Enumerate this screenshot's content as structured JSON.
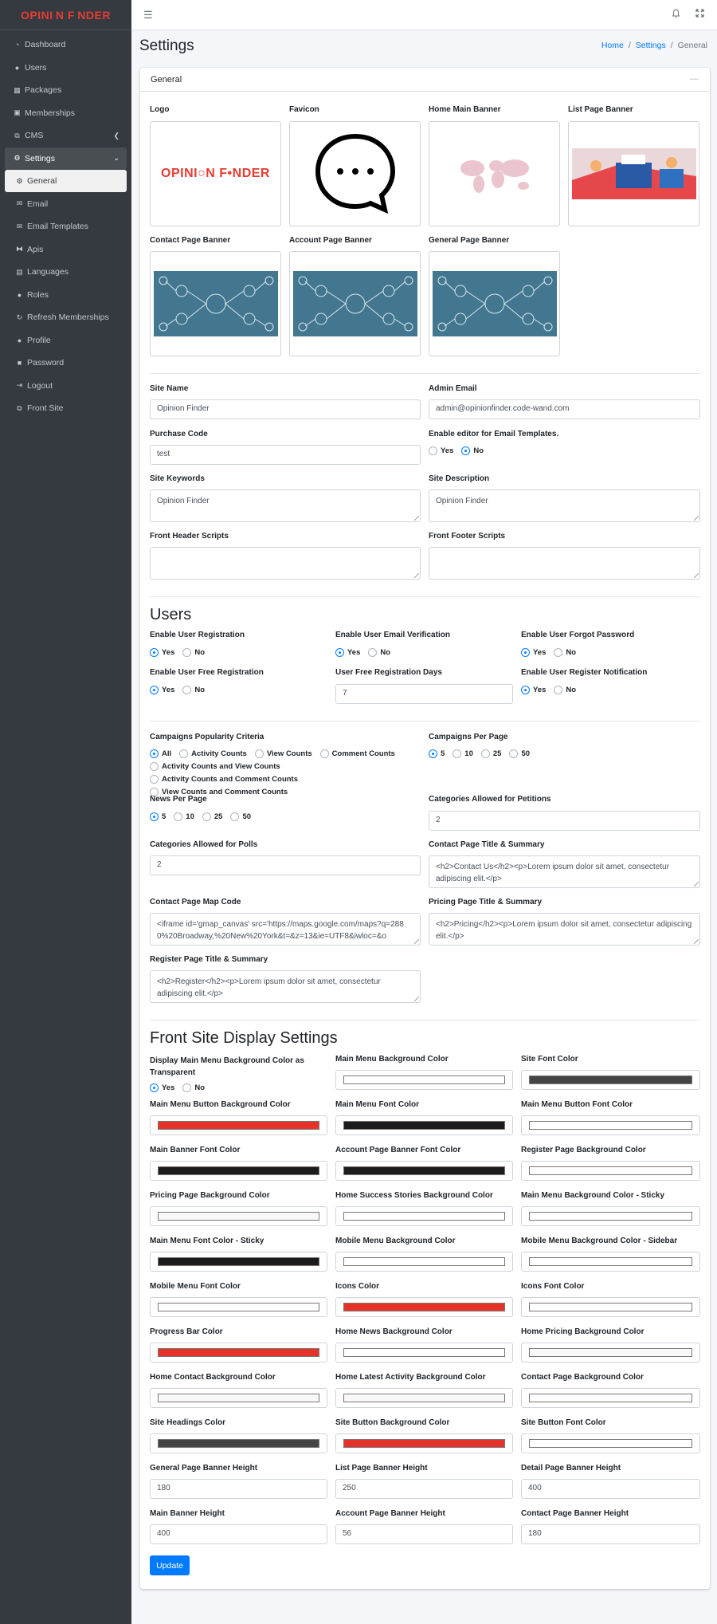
{
  "brand": {
    "name": "OPINI N F NDER"
  },
  "sidebar": {
    "items": [
      {
        "label": "Dashboard",
        "icon": "dashboard-icon"
      },
      {
        "label": "Users",
        "icon": "user-icon"
      },
      {
        "label": "Packages",
        "icon": "table-icon"
      },
      {
        "label": "Memberships",
        "icon": "membership-icon"
      },
      {
        "label": "CMS",
        "icon": "sitemap-icon"
      },
      {
        "label": "Settings",
        "icon": "cogs-icon"
      },
      {
        "label": "General",
        "icon": "cog-icon"
      },
      {
        "label": "Email",
        "icon": "envelope-icon"
      },
      {
        "label": "Email Templates",
        "icon": "envelope-icon"
      },
      {
        "label": "Apis",
        "icon": "api-icon"
      },
      {
        "label": "Languages",
        "icon": "language-icon"
      },
      {
        "label": "Roles",
        "icon": "users-icon"
      },
      {
        "label": "Refresh Memberships",
        "icon": "refresh-icon"
      },
      {
        "label": "Profile",
        "icon": "user-icon"
      },
      {
        "label": "Password",
        "icon": "lock-icon"
      },
      {
        "label": "Logout",
        "icon": "logout-icon"
      },
      {
        "label": "Front Site",
        "icon": "external-link-icon"
      }
    ]
  },
  "header": {
    "title": "Settings",
    "breadcrumb": [
      "Home",
      "Settings",
      "General"
    ]
  },
  "card": {
    "title": "General",
    "collapse": "—"
  },
  "images": {
    "logo": "Logo",
    "favicon": "Favicon",
    "home_banner": "Home Main Banner",
    "list_banner": "List Page Banner",
    "contact_banner": "Contact Page Banner",
    "account_banner": "Account Page Banner",
    "general_banner": "General Page Banner",
    "logo_text": "OPINI○N F•NDER"
  },
  "site": {
    "site_name_label": "Site Name",
    "site_name": "Opinion Finder",
    "admin_email_label": "Admin Email",
    "admin_email": "admin@opinionfinder.code-wand.com",
    "purchase_code_label": "Purchase Code",
    "purchase_code": "test",
    "editor_label": "Enable editor for Email Templates.",
    "keywords_label": "Site Keywords",
    "keywords": "Opinion Finder",
    "description_label": "Site Description",
    "description": "Opinion Finder",
    "header_scripts_label": "Front Header Scripts",
    "footer_scripts_label": "Front Footer Scripts"
  },
  "radio": {
    "yes": "Yes",
    "no": "No"
  },
  "users": {
    "title": "Users",
    "enable_registration": "Enable User Registration",
    "enable_email_verification": "Enable User Email Verification",
    "enable_forgot_password": "Enable User Forgot Password",
    "enable_free_registration": "Enable User Free Registration",
    "free_registration_days_label": "User Free Registration Days",
    "free_registration_days": "7",
    "enable_register_notification": "Enable User Register Notification"
  },
  "campaigns": {
    "criteria_label": "Campaigns Popularity Criteria",
    "criteria_options": [
      "All",
      "Activity Counts",
      "View Counts",
      "Comment Counts",
      "Activity Counts and View Counts",
      "Activity Counts and Comment Counts",
      "View Counts and Comment Counts"
    ],
    "per_page_label": "Campaigns Per Page",
    "per_page_options": [
      "5",
      "10",
      "25",
      "50"
    ],
    "news_per_page_label": "News Per Page",
    "news_per_page_options": [
      "5",
      "10",
      "25",
      "50"
    ],
    "categories_petitions_label": "Categories Allowed for Petitions",
    "categories_petitions": "2",
    "categories_polls_label": "Categories Allowed for Polls",
    "categories_polls": "2",
    "contact_title_label": "Contact Page Title & Summary",
    "contact_title": "<h2>Contact Us</h2><p>Lorem ipsum dolor sit amet, consectetur adipiscing elit.</p>",
    "map_code_label": "Contact Page Map Code",
    "map_code": "<iframe id='gmap_canvas' src='https://maps.google.com/maps?q=2880%20Broadway,%20New%20York&t=&z=13&ie=UTF8&iwloc=&o",
    "pricing_title_label": "Pricing Page Title & Summary",
    "pricing_title": "<h2>Pricing</h2><p>Lorem ipsum dolor sit amet, consectetur adipiscing elit.</p>",
    "register_title_label": "Register Page Title & Summary",
    "register_title": "<h2>Register</h2><p>Lorem ipsum dolor sit amet, consectetur adipiscing elit.</p>"
  },
  "display": {
    "title": "Front Site Display Settings",
    "transparent_label": "Display Main Menu Background Color as Transparent",
    "colors": [
      {
        "label": "Main Menu Background Color",
        "value": "#ffffff"
      },
      {
        "label": "Site Font Color",
        "value": "#444444"
      },
      {
        "label": "Main Menu Button Background Color",
        "value": "#e6332a"
      },
      {
        "label": "Main Menu Font Color",
        "value": "#1c1c1c"
      },
      {
        "label": "Main Menu Button Font Color",
        "value": "#ffffff"
      },
      {
        "label": "Main Banner Font Color",
        "value": "#1c1c1c"
      },
      {
        "label": "Account Page Banner Font Color",
        "value": "#1c1c1c"
      },
      {
        "label": "Register Page Background Color",
        "value": "#ffffff"
      },
      {
        "label": "Pricing Page Background Color",
        "value": "#f8f8f8"
      },
      {
        "label": "Home Success Stories Background Color",
        "value": "#ffffff"
      },
      {
        "label": "Main Menu Background Color - Sticky",
        "value": "#ffffff"
      },
      {
        "label": "Main Menu Font Color - Sticky",
        "value": "#1c1c1c"
      },
      {
        "label": "Mobile Menu Background Color",
        "value": "#ffffff"
      },
      {
        "label": "Mobile Menu Background Color - Sidebar",
        "value": "#ffffff"
      },
      {
        "label": "Mobile Menu Font Color",
        "value": "#ffffff"
      },
      {
        "label": "Icons Color",
        "value": "#e6332a"
      },
      {
        "label": "Icons Font Color",
        "value": "#ffffff"
      },
      {
        "label": "Progress Bar Color",
        "value": "#e6332a"
      },
      {
        "label": "Home News Background Color",
        "value": "#ffffff"
      },
      {
        "label": "Home Pricing Background Color",
        "value": "#f8f8f8"
      },
      {
        "label": "Home Contact Background Color",
        "value": "#f8f8f8"
      },
      {
        "label": "Home Latest Activity Background Color",
        "value": "#f8f8f8"
      },
      {
        "label": "Contact Page Background Color",
        "value": "#ffffff"
      },
      {
        "label": "Site Headings Color",
        "value": "#444444"
      },
      {
        "label": "Site Button Background Color",
        "value": "#e6332a"
      },
      {
        "label": "Site Button Font Color",
        "value": "#ffffff"
      }
    ],
    "heights": [
      {
        "label": "General Page Banner Height",
        "value": "180"
      },
      {
        "label": "List Page Banner Height",
        "value": "250"
      },
      {
        "label": "Detail Page Banner Height",
        "value": "400"
      },
      {
        "label": "Main Banner Height",
        "value": "400"
      },
      {
        "label": "Account Page Banner Height",
        "value": "56"
      },
      {
        "label": "Contact Page Banner Height",
        "value": "180"
      }
    ]
  },
  "update_button": "Update"
}
